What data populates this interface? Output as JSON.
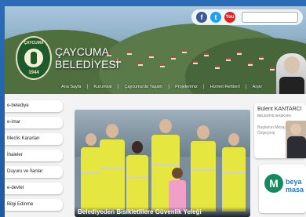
{
  "header": {
    "brand_line1": "ÇAYCUMA",
    "brand_line2": "BELEDİYESİ",
    "logo_ring_text": "ÇAYCUMA",
    "logo_year": "1944",
    "social": {
      "facebook": "f",
      "twitter": "t",
      "youtube": "You"
    },
    "search_placeholder": ""
  },
  "nav": {
    "items": [
      "Ana Sayfa",
      "Kurumsal",
      "Çaycuma'da Yaşam",
      "Projelerimiz",
      "Hizmet Rehberi",
      "Arşiv"
    ]
  },
  "sidebar": {
    "items": [
      "e-belediye",
      "e-imar",
      "Meclis Kararları",
      "İhaleler",
      "Duyuru ve İlanlar",
      "e-devlet",
      "Bilgi Edinme"
    ]
  },
  "slider": {
    "caption": "Belediyeden Bisikletlilere Güvenlik Yeleği"
  },
  "mayor": {
    "name": "Bülent KANTARCI",
    "role": "BELEDİYE BAŞKANI",
    "link1": "Başkanın Mesajı",
    "link2": "Özgeçmiş"
  },
  "beyaz": {
    "logo_letter": "M",
    "text_line1": "beya",
    "text_line2": "masa"
  },
  "colors": {
    "frame_blue": "#1f5fa8",
    "logo_green": "#1d5a2c",
    "vest_yellow": "#e6e640",
    "beyaz_green": "#138a5f",
    "beyaz_blue": "#2a7ab8"
  }
}
